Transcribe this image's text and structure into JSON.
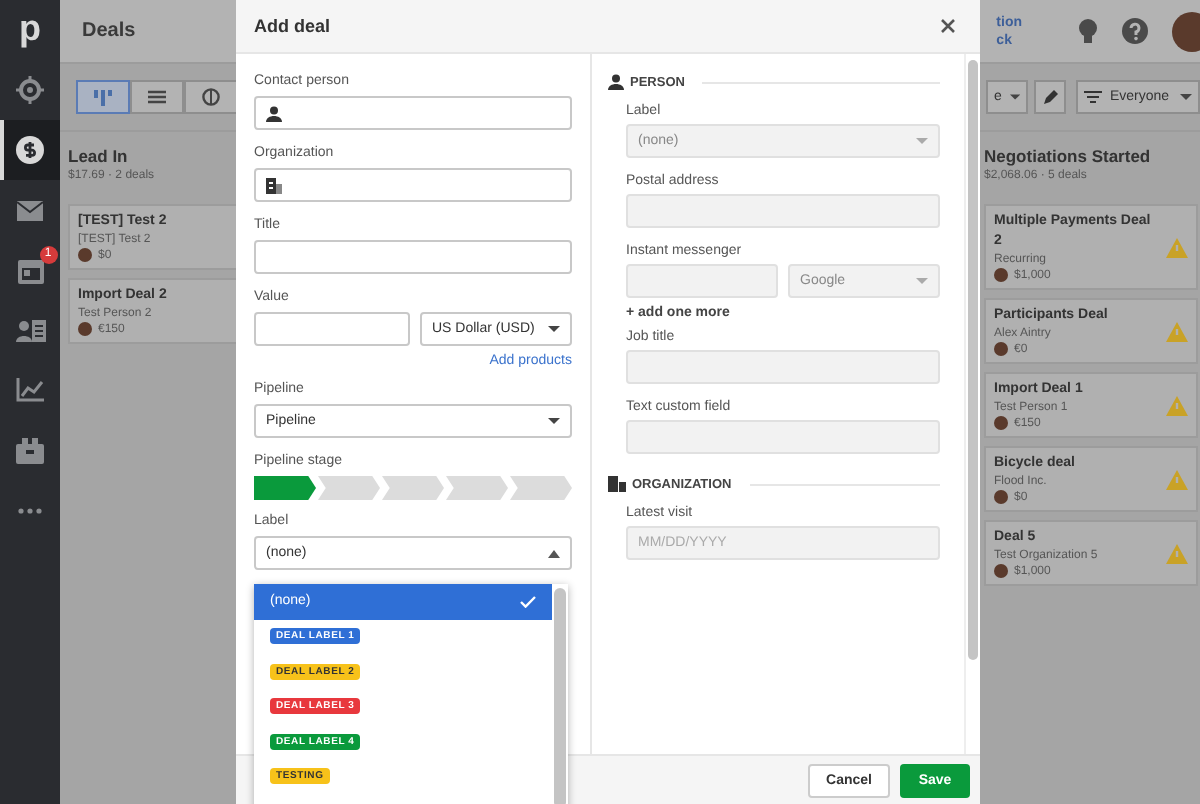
{
  "sidebar": {
    "logo": "p",
    "items": [
      {
        "selected": false
      },
      {
        "selected": true
      },
      {
        "selected": false
      },
      {
        "selected": false,
        "badge": "1"
      },
      {
        "selected": false
      },
      {
        "selected": false
      },
      {
        "selected": false
      },
      {
        "selected": false
      }
    ]
  },
  "top_bar": {
    "title": "Deals",
    "link_lines": [
      "tion",
      "ck"
    ]
  },
  "toolbar": {
    "views": [
      {
        "selected": true
      },
      {
        "selected": false
      },
      {
        "selected": false
      }
    ],
    "filter": "e",
    "owner": "Everyone"
  },
  "columns": [
    {
      "title": "Lead In",
      "summary": "$17.69 · 2 deals",
      "deals": [
        {
          "title": "[TEST] Test 2",
          "subtitle": "[TEST] Test 2",
          "value": "$0",
          "warning": false
        },
        {
          "title": "Import Deal 2",
          "subtitle": "Test Person 2",
          "value": "€150",
          "warning": false
        }
      ]
    },
    {
      "title": "Negotiations Started",
      "summary": "$2,068.06 · 5 deals",
      "deals": [
        {
          "title": "Multiple Payments Deal 2",
          "subtitle": "Recurring",
          "value": "$1,000",
          "warning": true
        },
        {
          "title": "Participants Deal",
          "subtitle": "Alex Aintry",
          "value": "€0",
          "warning": true
        },
        {
          "title": "Import Deal 1",
          "subtitle": "Test Person 1",
          "value": "€150",
          "warning": true
        },
        {
          "title": "Bicycle deal",
          "subtitle": "Flood Inc.",
          "value": "$0",
          "warning": true
        },
        {
          "title": "Deal 5",
          "subtitle": "Test Organization 5",
          "value": "$1,000",
          "warning": true
        }
      ]
    }
  ],
  "dialog": {
    "title": "Add deal",
    "contact_person": {
      "label": "Contact person"
    },
    "organization": {
      "label": "Organization"
    },
    "title_field": {
      "label": "Title"
    },
    "value": {
      "label": "Value",
      "currency": "US Dollar (USD)",
      "add_products": "Add products"
    },
    "pipeline": {
      "label": "Pipeline",
      "value": "Pipeline"
    },
    "pipeline_stage": {
      "label": "Pipeline stage",
      "stages": [
        {
          "active": true
        },
        {
          "active": false
        },
        {
          "active": false
        },
        {
          "active": false
        },
        {
          "active": false
        }
      ]
    },
    "deal_label": {
      "label": "Label",
      "value": "(none)",
      "expanded": true,
      "options": [
        {
          "kind": "plain",
          "text": "(none)",
          "selected": true
        },
        {
          "kind": "tag",
          "text": "DEAL LABEL 1",
          "color": "#2f6fd6",
          "selected": false
        },
        {
          "kind": "tag",
          "text": "DEAL LABEL 2",
          "color": "#f7c21a",
          "selected": false
        },
        {
          "kind": "tag",
          "text": "DEAL LABEL 3",
          "color": "#e8383d",
          "selected": false
        },
        {
          "kind": "tag",
          "text": "DEAL LABEL 4",
          "color": "#0a9a3c",
          "selected": false
        },
        {
          "kind": "tag",
          "text": "TESTING",
          "color": "#f7c21a",
          "selected": false
        }
      ]
    },
    "person": {
      "heading": "PERSON",
      "label": {
        "label": "Label",
        "value": "(none)"
      },
      "postal_address": {
        "label": "Postal address"
      },
      "instant_messenger": {
        "label": "Instant messenger",
        "service": "Google"
      },
      "add_more": "+ add one more",
      "job_title": {
        "label": "Job title"
      },
      "text_custom_field": {
        "label": "Text custom field"
      }
    },
    "org": {
      "heading": "ORGANIZATION",
      "latest_visit": {
        "label": "Latest visit",
        "placeholder": "MM/DD/YYYY"
      }
    },
    "buttons": {
      "cancel": "Cancel",
      "save": "Save"
    }
  }
}
